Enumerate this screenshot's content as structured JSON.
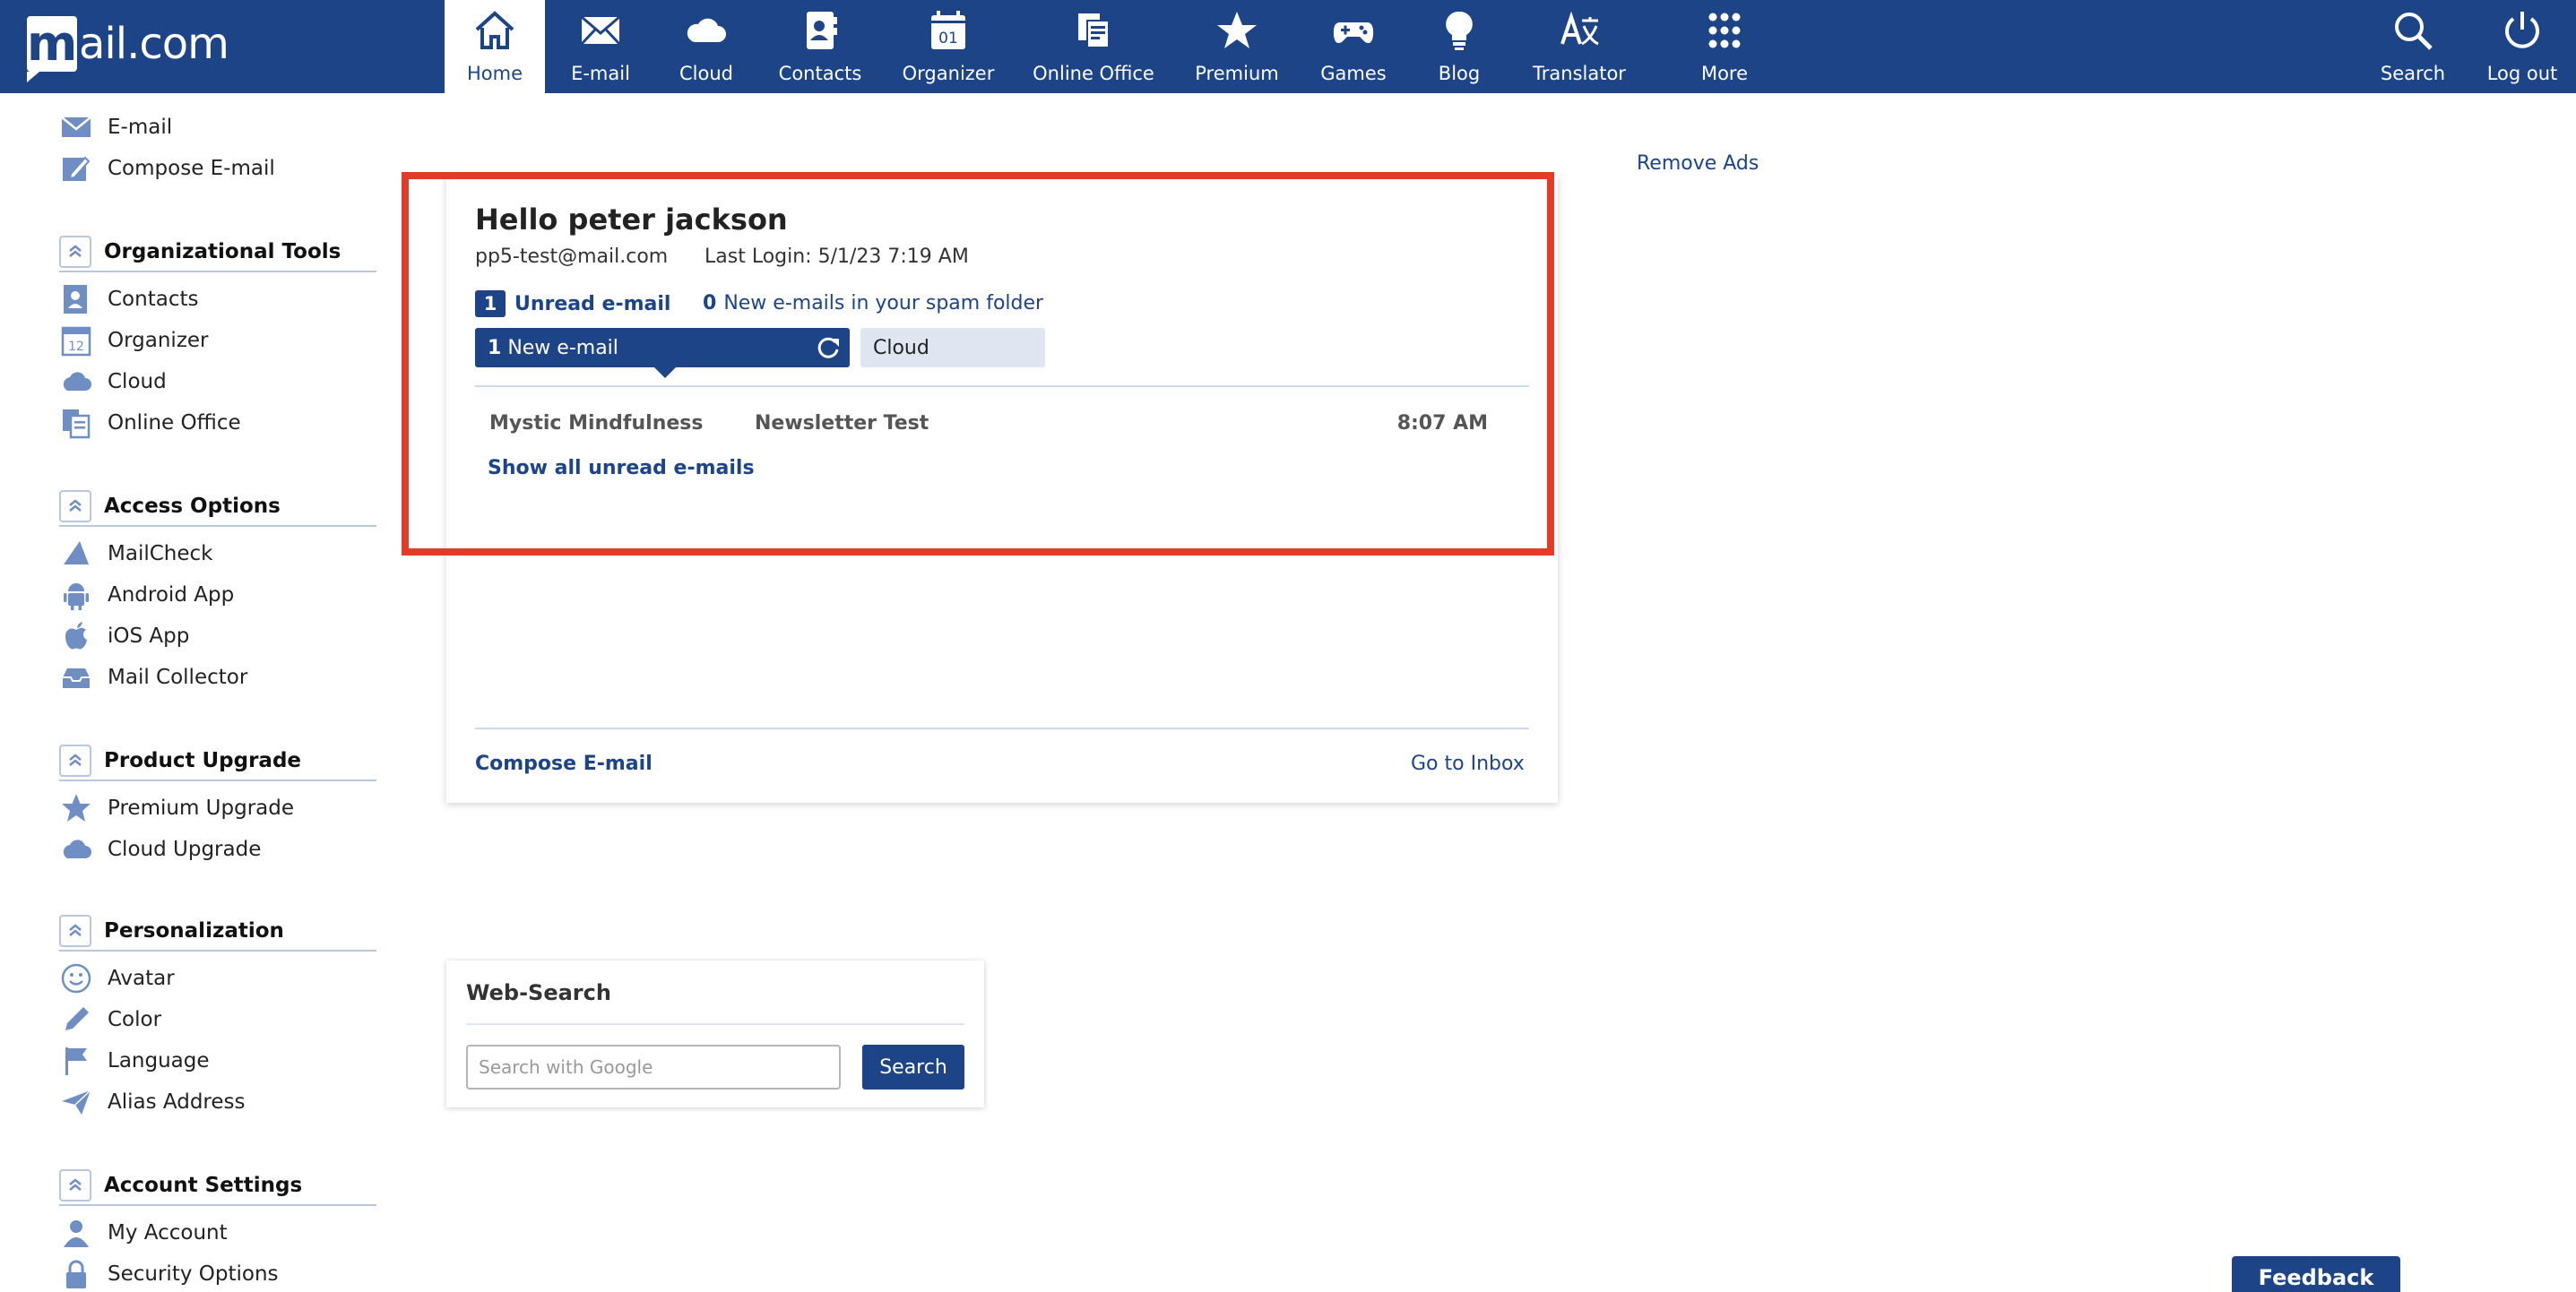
{
  "brand": {
    "logo_mark": "m",
    "logo_text": "ail.com"
  },
  "nav": {
    "items": [
      {
        "label": "Home",
        "icon": "home-icon"
      },
      {
        "label": "E-mail",
        "icon": "envelope-icon"
      },
      {
        "label": "Cloud",
        "icon": "cloud-icon"
      },
      {
        "label": "Contacts",
        "icon": "contacts-icon"
      },
      {
        "label": "Organizer",
        "icon": "calendar-icon",
        "icon_text": "01"
      },
      {
        "label": "Online Office",
        "icon": "office-icon"
      },
      {
        "label": "Premium",
        "icon": "star-icon"
      },
      {
        "label": "Games",
        "icon": "gamepad-icon"
      },
      {
        "label": "Blog",
        "icon": "lightbulb-icon"
      },
      {
        "label": "Translator",
        "icon": "translate-icon"
      },
      {
        "label": "More",
        "icon": "grid-icon"
      }
    ],
    "search_label": "Search",
    "logout_label": "Log out"
  },
  "sidebar": {
    "top": [
      {
        "label": "E-mail",
        "icon": "envelope-icon"
      },
      {
        "label": "Compose E-mail",
        "icon": "compose-icon"
      }
    ],
    "sections": [
      {
        "title": "Organizational Tools",
        "items": [
          {
            "label": "Contacts",
            "icon": "contacts-icon"
          },
          {
            "label": "Organizer",
            "icon": "calendar-icon",
            "icon_text": "12"
          },
          {
            "label": "Cloud",
            "icon": "cloud-icon"
          },
          {
            "label": "Online Office",
            "icon": "office-icon"
          }
        ]
      },
      {
        "title": "Access Options",
        "items": [
          {
            "label": "MailCheck",
            "icon": "megaphone-icon"
          },
          {
            "label": "Android App",
            "icon": "android-icon"
          },
          {
            "label": "iOS App",
            "icon": "apple-icon"
          },
          {
            "label": "Mail Collector",
            "icon": "inbox-tray-icon"
          }
        ]
      },
      {
        "title": "Product Upgrade",
        "items": [
          {
            "label": "Premium Upgrade",
            "icon": "star-icon"
          },
          {
            "label": "Cloud Upgrade",
            "icon": "cloud-icon"
          }
        ]
      },
      {
        "title": "Personalization",
        "items": [
          {
            "label": "Avatar",
            "icon": "smiley-icon"
          },
          {
            "label": "Color",
            "icon": "pencil-icon"
          },
          {
            "label": "Language",
            "icon": "flag-icon"
          },
          {
            "label": "Alias Address",
            "icon": "paper-plane-icon"
          }
        ]
      },
      {
        "title": "Account Settings",
        "items": [
          {
            "label": "My Account",
            "icon": "user-icon"
          },
          {
            "label": "Security Options",
            "icon": "lock-icon"
          }
        ]
      }
    ]
  },
  "main": {
    "greeting": "Hello peter jackson",
    "email": "pp5-test@mail.com",
    "last_login": "Last Login: 5/1/23 7:19 AM",
    "unread_count": "1",
    "unread_label": "Unread e-mail",
    "spam_count": "0",
    "spam_label": "New e-mails in your spam folder",
    "tab_new_count": "1",
    "tab_new_label": "New e-mail",
    "tab_cloud_label": "Cloud",
    "emails": [
      {
        "from": "Mystic Mindfulness",
        "subject": "Newsletter Test",
        "time": "8:07 AM"
      }
    ],
    "show_all": "Show all unread e-mails",
    "compose_link": "Compose E-mail",
    "inbox_link": "Go to Inbox",
    "remove_ads": "Remove Ads"
  },
  "websearch": {
    "title": "Web-Search",
    "placeholder": "Search with Google",
    "button": "Search"
  },
  "feedback": "Feedback",
  "colors": {
    "brand_blue": "#1c4487",
    "highlight_red": "#e13c28",
    "tab_inactive": "#dfe6f1"
  }
}
